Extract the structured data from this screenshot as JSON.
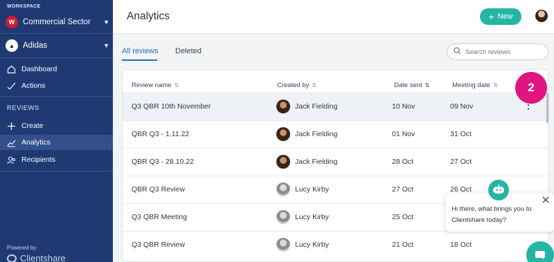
{
  "sidebar": {
    "workspace_label": "WORKSPACE",
    "workspace_name": "Commercial Sector",
    "client_name": "Adidas",
    "nav": [
      {
        "label": "Dashboard",
        "icon": "home-icon"
      },
      {
        "label": "Actions",
        "icon": "check-icon"
      }
    ],
    "reviews_label": "REVIEWS",
    "reviews_nav": [
      {
        "label": "Create",
        "icon": "plus-icon"
      },
      {
        "label": "Analytics",
        "icon": "chart-line-icon",
        "active": true
      },
      {
        "label": "Recipients",
        "icon": "user-search-icon"
      }
    ],
    "powered_by": "Powered by",
    "brand": "Clientshare"
  },
  "header": {
    "title": "Analytics",
    "new_button": "New"
  },
  "tabs": [
    {
      "label": "All reviews",
      "active": true
    },
    {
      "label": "Deleted",
      "active": false
    }
  ],
  "search": {
    "placeholder": "Search reviews"
  },
  "table": {
    "columns": [
      "Review name",
      "Created by",
      "Date sent",
      "Meeting date"
    ],
    "rows": [
      {
        "name": "Q3 QBR 10th November",
        "created_by": "Jack Fielding",
        "date_sent": "10 Nov",
        "meeting_date": "09 Nov"
      },
      {
        "name": "QBR Q3 - 1.11.22",
        "created_by": "Jack Fielding",
        "date_sent": "01 Nov",
        "meeting_date": "31 Oct"
      },
      {
        "name": "QBR Q3 - 28.10.22",
        "created_by": "Jack Fielding",
        "date_sent": "28 Oct",
        "meeting_date": "27 Oct"
      },
      {
        "name": "QBR Q3 Review",
        "created_by": "Lucy Kirby",
        "date_sent": "27 Oct",
        "meeting_date": "26 Oct"
      },
      {
        "name": "Q3 QBR Meeting",
        "created_by": "Lucy Kirby",
        "date_sent": "25 Oct",
        "meeting_date": ""
      },
      {
        "name": "Q3 QBR Review",
        "created_by": "Lucy Kirby",
        "date_sent": "21 Oct",
        "meeting_date": "18 Oct"
      }
    ]
  },
  "step_badge": "2",
  "chat": {
    "message": "Hi there, what brings you to Clientshare today?"
  },
  "colors": {
    "sidebar": "#1f3a73",
    "accent": "#25b5a7",
    "link": "#1f6fbf",
    "badge": "#e0157f"
  }
}
